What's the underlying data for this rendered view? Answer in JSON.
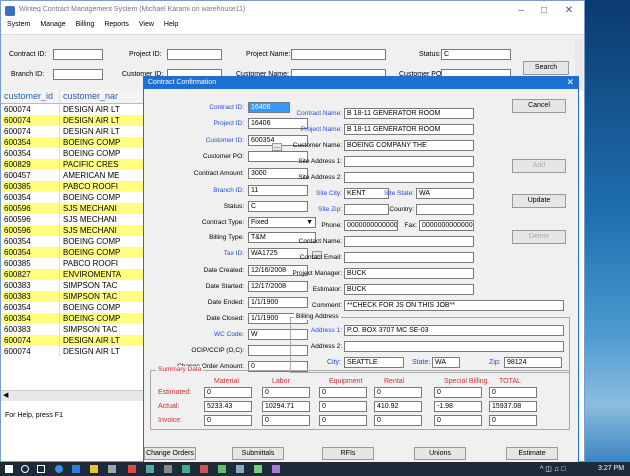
{
  "main_window": {
    "title": "Winteq Contract Management System (Michael Karami on warehouse11)",
    "menu": [
      "System",
      "Manage",
      "Billing",
      "Reports",
      "View",
      "Help"
    ],
    "filters": {
      "contract_id_label": "Contract ID:",
      "contract_id": "",
      "project_id_label": "Project ID:",
      "project_id": "",
      "project_name_label": "Project Name:",
      "project_name": "",
      "status_label": "Status:",
      "status": "C",
      "branch_id_label": "Branch ID:",
      "branch_id": "",
      "customer_id_label": "Customer ID:",
      "customer_id": "",
      "customer_name_label": "Customer Name:",
      "customer_name": "",
      "customer_po_label": "Customer PO:",
      "customer_po": "",
      "search_label": "Search"
    },
    "grid": {
      "columns": [
        "customer_id",
        "customer_nar"
      ],
      "rows": [
        {
          "id": "600074",
          "name": "DESIGN AIR LT",
          "hl": false
        },
        {
          "id": "600074",
          "name": "DESIGN AIR LT",
          "hl": true
        },
        {
          "id": "600074",
          "name": "DESIGN AIR LT",
          "hl": false
        },
        {
          "id": "600354",
          "name": "BOEING COMP",
          "hl": true
        },
        {
          "id": "600354",
          "name": "BOEING COMP",
          "hl": false
        },
        {
          "id": "600829",
          "name": "PACIFIC CRES",
          "hl": true
        },
        {
          "id": "600457",
          "name": "AMERICAN ME",
          "hl": false
        },
        {
          "id": "600385",
          "name": "PABCO ROOFI",
          "hl": true
        },
        {
          "id": "600354",
          "name": "BOEING COMP",
          "hl": false
        },
        {
          "id": "600596",
          "name": "SJS MECHANI",
          "hl": true
        },
        {
          "id": "600596",
          "name": "SJS MECHANI",
          "hl": false
        },
        {
          "id": "600596",
          "name": "SJS MECHANI",
          "hl": true
        },
        {
          "id": "600354",
          "name": "BOEING COMP",
          "hl": false
        },
        {
          "id": "600354",
          "name": "BOEING COMP",
          "hl": true
        },
        {
          "id": "600385",
          "name": "PABCO ROOFI",
          "hl": false
        },
        {
          "id": "600827",
          "name": "ENVIROMENTA",
          "hl": true
        },
        {
          "id": "600383",
          "name": "SIMPSON TAC",
          "hl": false
        },
        {
          "id": "600383",
          "name": "SIMPSON TAC",
          "hl": true
        },
        {
          "id": "600354",
          "name": "BOEING COMP",
          "hl": false
        },
        {
          "id": "600354",
          "name": "BOEING COMP",
          "hl": true
        },
        {
          "id": "600383",
          "name": "SIMPSON TAC",
          "hl": false
        },
        {
          "id": "600074",
          "name": "DESIGN AIR LT",
          "hl": true
        },
        {
          "id": "600074",
          "name": "DESIGN AIR LT",
          "hl": false
        }
      ]
    },
    "status_text": "For Help, press F1"
  },
  "dialog": {
    "title": "Contract Confirmation",
    "left": {
      "contract_id_label": "Contract ID:",
      "contract_id": "16406",
      "project_id_label": "Project ID:",
      "project_id": "16406",
      "customer_id_label": "Customer ID:",
      "customer_id": "600354",
      "customer_po_label": "Customer PO:",
      "customer_po": "",
      "contract_amount_label": "Contract Amount:",
      "contract_amount": "3000",
      "branch_id_label": "Branch ID:",
      "branch_id": "11",
      "status_label": "Status:",
      "status": "C",
      "contract_type_label": "Contract Type:",
      "contract_type": "Fixed",
      "billing_type_label": "Billing Type:",
      "billing_type": "T&M",
      "tax_id_label": "Tax ID:",
      "tax_id": "WA1725",
      "date_created_label": "Date Created:",
      "date_created": "12/16/2008",
      "date_started_label": "Date Started:",
      "date_started": "12/17/2008",
      "date_ended_label": "Date Ended:",
      "date_ended": "1/1/1900",
      "date_closed_label": "Date Closed:",
      "date_closed": "1/1/1900",
      "wc_code_label": "WC Code:",
      "wc_code": "W",
      "ocip_label": "OCIP/CCIP (O,C):",
      "ocip": "",
      "change_order_label": "Change Order Amount:",
      "change_order": "0"
    },
    "right": {
      "contract_name_label": "Contract Name:",
      "contract_name": "B 18-11 GENERATOR ROOM",
      "project_name_label": "Project Name:",
      "project_name": "B 18-11 GENERATOR ROOM",
      "customer_name_label": "Customer Name:",
      "customer_name": "BOEING COMPANY THE",
      "site_address1_label": "Site Address 1:",
      "site_address1": "",
      "site_address2_label": "Site Address 2:",
      "site_address2": "",
      "site_city_label": "Site City:",
      "site_city": "KENT",
      "site_state_label": "Site State:",
      "site_state": "WA",
      "site_zip_label": "Site Zip:",
      "site_zip": "",
      "country_label": "Country:",
      "country": "",
      "phone_label": "Phone:",
      "phone": "0000000000000",
      "fax_label": "Fax:",
      "fax": "0000000000000",
      "contact_name_label": "Contact Name:",
      "contact_name": "",
      "contact_email_label": "Contact Email:",
      "contact_email": "",
      "project_manager_label": "Project Manager:",
      "project_manager": "BUCK",
      "estimator_label": "Estimator:",
      "estimator": "BUCK",
      "comment_label": "Comment:",
      "comment": "**CHECK FOR JS ON THIS JOB**",
      "billing_address_label": "Billing Address",
      "address1_label": "Address 1:",
      "address1": "P.O. BOX 3707 MC SE-03",
      "address2_label": "Address 2:",
      "address2": "",
      "city_label": "City:",
      "city": "SEATTLE",
      "state_label": "State:",
      "state": "WA",
      "zip_label": "Zip:",
      "zip": "98124"
    },
    "side_buttons": {
      "cancel": "Cancel",
      "add": "Add",
      "update": "Update",
      "delete": "Delete"
    },
    "summary": {
      "label": "Summary Data",
      "columns": [
        "Material",
        "Labor",
        "Equipment",
        "Rental",
        "Special Billing",
        "TOTAL"
      ],
      "rows": [
        {
          "label": "Estimated:",
          "values": [
            "0",
            "0",
            "0",
            "0",
            "0",
            "0"
          ]
        },
        {
          "label": "Actual:",
          "values": [
            "5233.43",
            "10294.71",
            "0",
            "410.92",
            "-1.98",
            "15937.08"
          ]
        },
        {
          "label": "Invoice:",
          "values": [
            "0",
            "0",
            "0",
            "0",
            "0",
            "0"
          ]
        }
      ]
    },
    "bottom_buttons": {
      "change_orders": "Change Orders",
      "submittals": "Submittals",
      "rfis": "RFIs",
      "unions": "Unions",
      "estimate": "Estimate"
    }
  },
  "taskbar": {
    "time": "3:27 PM"
  }
}
